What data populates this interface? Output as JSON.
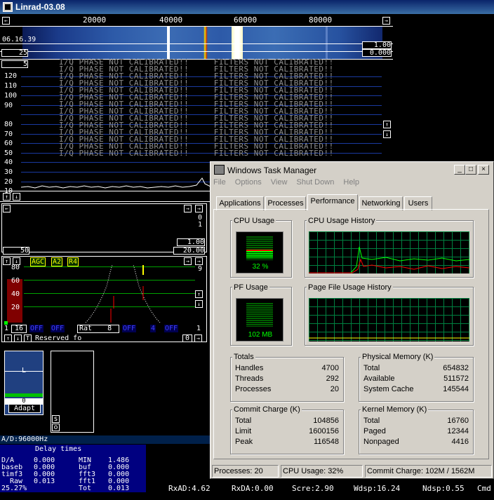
{
  "linrad": {
    "title": "Linrad-03.08",
    "freq_axis": [
      "20000",
      "40000",
      "60000",
      "80000"
    ],
    "wf_time": "06.16.39",
    "wf_gain": "1.00",
    "wf_offset": "0.000",
    "wf_avg": "25",
    "wf_val5": "5",
    "y_ticks": [
      "120",
      "110",
      "100",
      "90",
      "80",
      "70",
      "60",
      "50",
      "40",
      "30",
      "20",
      "10"
    ],
    "calib_lines": [
      "I/Q PHASE NOT CALIBRATED!!     FILTERS NOT CALIBRATED!!",
      "I/Q PHASE NOT CALIBRATED!!     FILTERS NOT CALIBRATED!!",
      "I/Q PHASE NOT CALIBRATED!!     FILTERS NOT CALIBRATED!!",
      "I/Q PHASE NOT CALIBRATED!!     FILTERS NOT CALIBRATED!!",
      "I/Q PHASE NOT CALIBRATED!!     FILTERS NOT CALIBRATED!!",
      "I/Q PHASE NOT CALIBRATED!!     FILTERS NOT CALIBRATED!!",
      "I/Q PHASE NOT CALIBRATED!!     FILTERS NOT CALIBRATED!!",
      "I/Q PHASE NOT CALIBRATED!!     FILTERS NOT CALIBRATED!!",
      "I/Q PHASE NOT CALIBRATED!!     FILTERS NOT CALIBRATED!!",
      "I/Q PHASE NOT CALIBRATED!!     FILTERS NOT CALIBRATED!!",
      "I/Q PHASE NOT CALIBRATED!!     FILTERS NOT CALIBRATED!!",
      "I/Q PHASE NOT CALIBRATED!!     FILTERS NOT CALIBRATED!!",
      "I/Q PHASE NOT CALIBRATED!!     FILTERS NOT CALIBRATED!!",
      "I/Q PHASE NOT CALIBRATED!!     FILTERS NOT CALIBRATED!!"
    ],
    "bw_right_0": "0",
    "bw_right_1": "1",
    "bw_gain": "1.00",
    "bw_left": "50",
    "bw_right": "20.00",
    "agc_labels": [
      "AGC",
      "A2",
      "R4"
    ],
    "bfo_axis": [
      "80",
      "60",
      "40",
      "20"
    ],
    "bfo_right": [
      "9",
      "1"
    ],
    "bottom_row": {
      "v1": "1",
      "v2": "16",
      "off1": "OFF",
      "off2": "OFF",
      "rat_label": "Rat",
      "rat_val": "8",
      "off3": "OFF",
      "off4": "4",
      "off5": "OFF",
      "right": "1"
    },
    "reserved": "Reserved fo",
    "reserved_val": "0",
    "s_meter": {
      "l_label": "L",
      "val": "0",
      "adapt": "Adapt"
    },
    "so": [
      "s",
      "o"
    ],
    "ad": "A/D:96000Hz",
    "delay_title": "Delay times",
    "delay_rows": [
      [
        "D/A",
        "0.000",
        "MIN",
        "1.486"
      ],
      [
        "baseb",
        "0.000",
        "buf",
        "0.000"
      ],
      [
        "timf3",
        "0.000",
        "fft3",
        "0.000"
      ],
      [
        "Raw",
        "0.013",
        "fft1",
        "0.000"
      ],
      [
        "25.27%",
        "",
        "Tot",
        "0.013"
      ]
    ],
    "status": [
      "RxAD:4.62",
      "RxDA:0.00",
      "Scre:2.90",
      "Wdsp:16.24",
      "Ndsp:0.55",
      "Cmd"
    ]
  },
  "taskmgr": {
    "title": "Windows Task Manager",
    "buttons": {
      "min": "_",
      "max": "□",
      "close": "×"
    },
    "menu": [
      "File",
      "Options",
      "View",
      "Shut Down",
      "Help"
    ],
    "tabs": [
      "Applications",
      "Processes",
      "Performance",
      "Networking",
      "Users"
    ],
    "active_tab": "Performance",
    "cpu_usage_label": "CPU Usage",
    "cpu_usage_value": "32 %",
    "cpu_usage_fraction": 0.32,
    "cpu_history_label": "CPU Usage History",
    "pf_usage_label": "PF Usage",
    "pf_usage_value": "102 MB",
    "pf_history_label": "Page File Usage History",
    "totals": {
      "title": "Totals",
      "rows": [
        [
          "Handles",
          "4700"
        ],
        [
          "Threads",
          "292"
        ],
        [
          "Processes",
          "20"
        ]
      ]
    },
    "physical": {
      "title": "Physical Memory (K)",
      "rows": [
        [
          "Total",
          "654832"
        ],
        [
          "Available",
          "511572"
        ],
        [
          "System Cache",
          "145544"
        ]
      ]
    },
    "commit": {
      "title": "Commit Charge (K)",
      "rows": [
        [
          "Total",
          "104856"
        ],
        [
          "Limit",
          "1600156"
        ],
        [
          "Peak",
          "116548"
        ]
      ]
    },
    "kernel": {
      "title": "Kernel Memory (K)",
      "rows": [
        [
          "Total",
          "16760"
        ],
        [
          "Paged",
          "12344"
        ],
        [
          "Nonpaged",
          "4416"
        ]
      ]
    },
    "statusbar": {
      "processes": "Processes: 20",
      "cpu": "CPU Usage: 32%",
      "commit": "Commit Charge: 102M / 1562M"
    },
    "colors": {
      "graph_green": "#00ff00",
      "graph_red": "#ff0000",
      "grid": "#008040"
    }
  }
}
